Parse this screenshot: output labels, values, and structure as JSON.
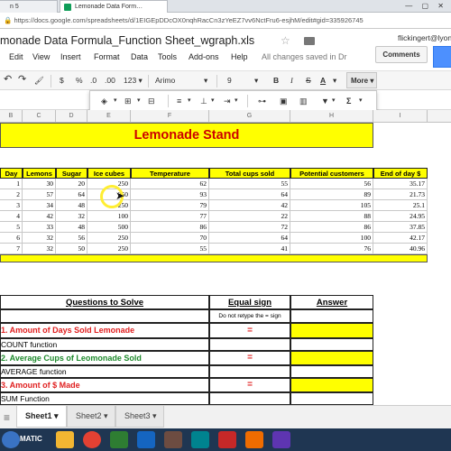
{
  "browser": {
    "tabs": [
      {
        "label": "n 5"
      },
      {
        "label": "Lemonade Data Form…"
      }
    ],
    "url": "https://docs.google.com/spreadsheets/d/1EIGEpDDcOX0nqhRacCn3zYeEZ7vv6NctFru6-esjhM/edit#gid=335926745"
  },
  "header": {
    "title": "monade Data Formula_Function Sheet_wgraph.xls",
    "user": "flickingert@lyon",
    "comments_label": "Comments",
    "save_status": "All changes saved in Dr"
  },
  "menu": [
    "Edit",
    "View",
    "Insert",
    "Format",
    "Data",
    "Tools",
    "Add-ons",
    "Help"
  ],
  "toolbar": {
    "currency": "$",
    "percent": "%",
    "dec_less": ".0",
    "dec_more": ".00",
    "number_format": "123",
    "font": "Arimo",
    "font_size": "9",
    "bold": "B",
    "italic": "I",
    "strike": "S",
    "text_color": "A",
    "more_label": "More"
  },
  "columns": [
    "B",
    "C",
    "D",
    "E",
    "F",
    "G",
    "H",
    "I"
  ],
  "sheet": {
    "title": "Lemonade Stand",
    "headers": [
      "Day",
      "Lemons",
      "Sugar",
      "Ice cubes",
      "Temperature",
      "Total cups sold",
      "Potential customers",
      "End of day $"
    ],
    "rows": [
      [
        "1",
        "30",
        "20",
        "250",
        "62",
        "55",
        "56",
        "35.17"
      ],
      [
        "2",
        "57",
        "64",
        "250",
        "93",
        "64",
        "89",
        "21.73"
      ],
      [
        "3",
        "34",
        "48",
        "250",
        "79",
        "42",
        "105",
        "25.1"
      ],
      [
        "4",
        "42",
        "32",
        "100",
        "77",
        "22",
        "88",
        "24.95"
      ],
      [
        "5",
        "33",
        "48",
        "500",
        "86",
        "72",
        "86",
        "37.85"
      ],
      [
        "6",
        "32",
        "56",
        "250",
        "70",
        "64",
        "100",
        "42.17"
      ],
      [
        "7",
        "32",
        "50",
        "250",
        "55",
        "41",
        "76",
        "40.96"
      ]
    ]
  },
  "questions": {
    "col_title": "Questions to Solve",
    "col_equal": "Equal sign",
    "col_equal_note": "Do not retype the = sign",
    "col_answer": "Answer",
    "items": [
      {
        "q": "1. Amount of Days Sold Lemonade",
        "fn": "COUNT function",
        "eq": "="
      },
      {
        "q": "2. Average Cups of Leomonade Sold",
        "fn": "AVERAGE function",
        "eq": "="
      },
      {
        "q": "3. Amount of $ Made",
        "fn": "SUM Function",
        "eq": "="
      }
    ]
  },
  "sheet_tabs": [
    "Sheet1",
    "Sheet2",
    "Sheet3"
  ],
  "taskbar": {
    "start": "MATIC"
  },
  "colors": {
    "highlight": "#ffff00",
    "title_red": "#cc0000",
    "q_green": "#1e8a2c",
    "q_red": "#e02020"
  }
}
